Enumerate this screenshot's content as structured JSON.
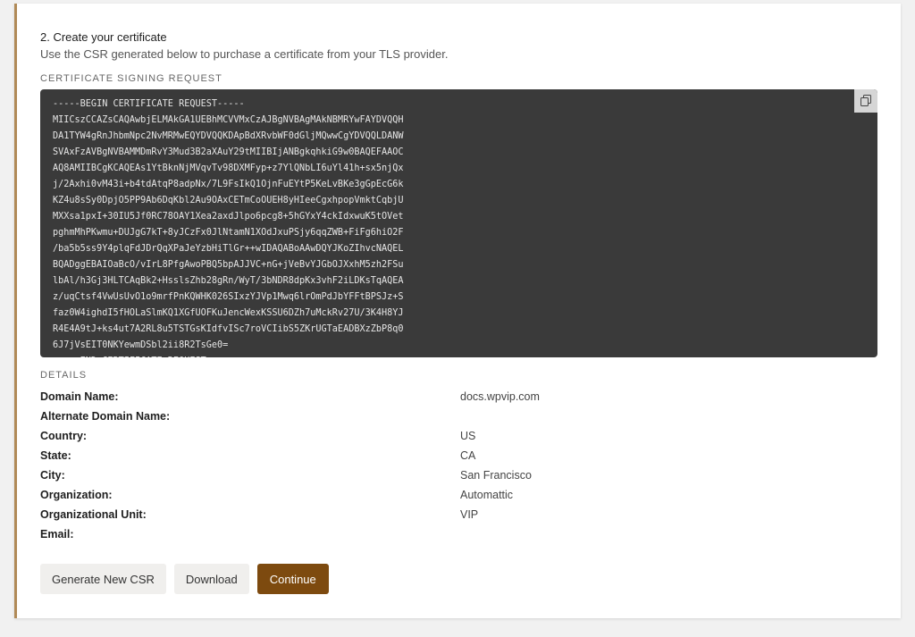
{
  "step": {
    "title": "2. Create your certificate",
    "description": "Use the CSR generated below to purchase a certificate from your TLS provider."
  },
  "csr": {
    "label": "CERTIFICATE SIGNING REQUEST",
    "copy_icon": "copy-icon",
    "lines": [
      "-----BEGIN CERTIFICATE REQUEST-----",
      "MIICszCCAZsCAQAwbjELMAkGA1UEBhMCVVMxCzAJBgNVBAgMAkNBMRYwFAYDVQQH",
      "DA1TYW4gRnJhbmNpc2NvMRMwEQYDVQQKDApBdXRvbWF0dGljMQwwCgYDVQQLDANW",
      "SVAxFzAVBgNVBAMMDmRvY3Mud3B2aXAuY29tMIIBIjANBgkqhkiG9w0BAQEFAAOC",
      "AQ8AMIIBCgKCAQEAs1YtBknNjMVqvTv98DXMFyp+z7YlQNbLI6uYl41h+sx5njQx",
      "j/2Axhi0vM43i+b4tdAtqP8adpNx/7L9FsIkQ1OjnFuEYtP5KeLvBKe3gGpEcG6k",
      "KZ4u8sSy0DpjO5PP9Ab6DqKbl2Au9OAxCETmCoOUEH8yHIeeCgxhpopVmktCqbjU",
      "MXXsa1pxI+30IU5Jf0RC78OAY1Xea2axdJlpo6pcg8+5hGYxY4ckIdxwuK5tOVet",
      "pghmMhPKwmu+DUJgG7kT+8yJCzFx0JlNtamN1XOdJxuPSjy6qqZWB+FiFg6hiO2F",
      "/ba5b5ss9Y4plqFdJDrQqXPaJeYzbHiTlGr++wIDAQABoAAwDQYJKoZIhvcNAQEL",
      "BQADggEBAIOaBcO/vIrL8PfgAwoPBQ5bpAJJVC+nG+jVeBvYJGbOJXxhM5zh2FSu",
      "lbAl/h3Gj3HLTCAqBk2+HsslsZhb28gRn/WyT/3bNDR8dpKx3vhF2iLDKsTqAQEA",
      "z/uqCtsf4VwUsUvO1o9mrfPnKQWHK026SIxzYJVp1Mwq6lrOmPdJbYFFtBPSJz+S",
      "faz0W4ighdI5fHOLaSlmKQ1XGfUOFKuJencWexKSSU6DZh7uMckRv27U/3K4H8YJ",
      "R4E4A9tJ+ks4ut7A2RL8u5TSTGsKIdfvISc7roVCIibS5ZKrUGTaEADBXzZbP8q0",
      "6J7jVsEIT0NKYewmDSbl2ii8R2TsGe0=",
      "-----END CERTIFICATE REQUEST-----"
    ]
  },
  "details": {
    "label": "DETAILS",
    "rows": [
      {
        "label": "Domain Name:",
        "value": "docs.wpvip.com"
      },
      {
        "label": "Alternate Domain Name:",
        "value": ""
      },
      {
        "label": "Country:",
        "value": "US"
      },
      {
        "label": "State:",
        "value": "CA"
      },
      {
        "label": "City:",
        "value": "San Francisco"
      },
      {
        "label": "Organization:",
        "value": "Automattic"
      },
      {
        "label": "Organizational Unit:",
        "value": "VIP"
      },
      {
        "label": "Email:",
        "value": ""
      }
    ]
  },
  "actions": {
    "generate_label": "Generate New CSR",
    "download_label": "Download",
    "continue_label": "Continue"
  },
  "colors": {
    "accent": "#7d4a0f",
    "card_border": "#b08a57",
    "code_background": "#3a3a3a"
  }
}
